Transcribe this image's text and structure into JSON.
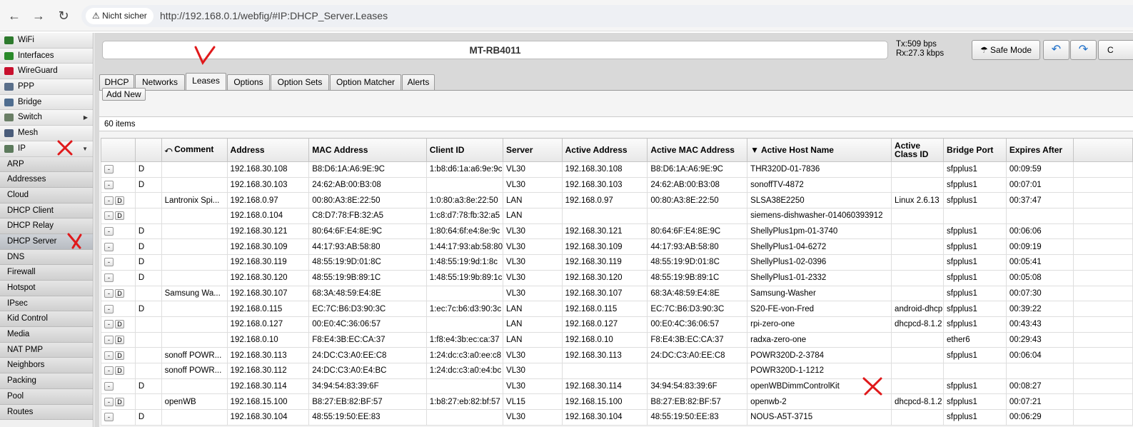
{
  "browser": {
    "back": "←",
    "forward": "→",
    "reload": "↻",
    "insecure": "⚠ Nicht sicher",
    "url": "http://192.168.0.1/webfig/#IP:DHCP_Server.Leases"
  },
  "sidebar": {
    "items": [
      {
        "label": "WiFi",
        "icon_color": "#2d7a2d",
        "has_arrow": false
      },
      {
        "label": "Interfaces",
        "icon_color": "#2a8a2a",
        "has_arrow": false
      },
      {
        "label": "WireGuard",
        "icon_color": "#c8102e",
        "has_arrow": false
      },
      {
        "label": "PPP",
        "icon_color": "#5a6f8a",
        "has_arrow": false
      },
      {
        "label": "Bridge",
        "icon_color": "#4f6d8f",
        "has_arrow": false
      },
      {
        "label": "Switch",
        "icon_color": "#6a7f66",
        "has_arrow": true
      },
      {
        "label": "Mesh",
        "icon_color": "#4a5c7a",
        "has_arrow": false
      },
      {
        "label": "IP",
        "icon_color": "#5c7a5c",
        "has_arrow": true
      }
    ],
    "arrow": "▶",
    "open_arrow": "▼",
    "sub_items": [
      "ARP",
      "Addresses",
      "Cloud",
      "DHCP Client",
      "DHCP Relay",
      "DHCP Server",
      "DNS",
      "Firewall",
      "Hotspot",
      "IPsec",
      "Kid Control",
      "Media",
      "NAT PMP",
      "Neighbors",
      "Packing",
      "Pool",
      "Routes"
    ],
    "active_sub": "DHCP Server"
  },
  "header": {
    "title": "MT-RB4011",
    "tx": "Tx:509 bps",
    "rx": "Rx:27.3 kbps",
    "safe_mode": "Safe Mode",
    "undo": "↶",
    "redo": "↷",
    "extra": "C"
  },
  "tabs": [
    "DHCP",
    "Networks",
    "Leases",
    "Options",
    "Option Sets",
    "Option Matcher",
    "Alerts"
  ],
  "active_tab": "Leases",
  "toolbar": {
    "add_new": "Add New"
  },
  "items_count": "60 items",
  "table": {
    "columns": [
      "",
      "",
      "Comment",
      "Address",
      "MAC Address",
      "Client ID",
      "Server",
      "Active Address",
      "Active MAC Address",
      "▼ Active Host Name",
      "Active Class ID",
      "Bridge Port",
      "Expires After",
      ""
    ],
    "rows": [
      {
        "d_btn": false,
        "flag": "D",
        "comment": "",
        "address": "192.168.30.108",
        "mac": "B8:D6:1A:A6:9E:9C",
        "client_id": "1:b8:d6:1a:a6:9e:9c",
        "server": "VL30",
        "active_address": "192.168.30.108",
        "active_mac": "B8:D6:1A:A6:9E:9C",
        "host": "THR320D-01-7836",
        "class_id": "",
        "bridge_port": "sfpplus1",
        "expires": "00:09:59"
      },
      {
        "d_btn": false,
        "flag": "D",
        "comment": "",
        "address": "192.168.30.103",
        "mac": "24:62:AB:00:B3:08",
        "client_id": "",
        "server": "VL30",
        "active_address": "192.168.30.103",
        "active_mac": "24:62:AB:00:B3:08",
        "host": "sonoffTV-4872",
        "class_id": "",
        "bridge_port": "sfpplus1",
        "expires": "00:07:01"
      },
      {
        "d_btn": true,
        "flag": "",
        "comment": "Lantronix Spi...",
        "address": "192.168.0.97",
        "mac": "00:80:A3:8E:22:50",
        "client_id": "1:0:80:a3:8e:22:50",
        "server": "LAN",
        "active_address": "192.168.0.97",
        "active_mac": "00:80:A3:8E:22:50",
        "host": "SLSA38E2250",
        "class_id": "Linux 2.6.13",
        "bridge_port": "sfpplus1",
        "expires": "00:37:47"
      },
      {
        "d_btn": true,
        "flag": "",
        "comment": "",
        "address": "192.168.0.104",
        "mac": "C8:D7:78:FB:32:A5",
        "client_id": "1:c8:d7:78:fb:32:a5",
        "server": "LAN",
        "active_address": "",
        "active_mac": "",
        "host": "siemens-dishwasher-014060393912",
        "class_id": "",
        "bridge_port": "",
        "expires": ""
      },
      {
        "d_btn": false,
        "flag": "D",
        "comment": "",
        "address": "192.168.30.121",
        "mac": "80:64:6F:E4:8E:9C",
        "client_id": "1:80:64:6f:e4:8e:9c",
        "server": "VL30",
        "active_address": "192.168.30.121",
        "active_mac": "80:64:6F:E4:8E:9C",
        "host": "ShellyPlus1pm-01-3740",
        "class_id": "",
        "bridge_port": "sfpplus1",
        "expires": "00:06:06"
      },
      {
        "d_btn": false,
        "flag": "D",
        "comment": "",
        "address": "192.168.30.109",
        "mac": "44:17:93:AB:58:80",
        "client_id": "1:44:17:93:ab:58:80",
        "server": "VL30",
        "active_address": "192.168.30.109",
        "active_mac": "44:17:93:AB:58:80",
        "host": "ShellyPlus1-04-6272",
        "class_id": "",
        "bridge_port": "sfpplus1",
        "expires": "00:09:19"
      },
      {
        "d_btn": false,
        "flag": "D",
        "comment": "",
        "address": "192.168.30.119",
        "mac": "48:55:19:9D:01:8C",
        "client_id": "1:48:55:19:9d:1:8c",
        "server": "VL30",
        "active_address": "192.168.30.119",
        "active_mac": "48:55:19:9D:01:8C",
        "host": "ShellyPlus1-02-0396",
        "class_id": "",
        "bridge_port": "sfpplus1",
        "expires": "00:05:41"
      },
      {
        "d_btn": false,
        "flag": "D",
        "comment": "",
        "address": "192.168.30.120",
        "mac": "48:55:19:9B:89:1C",
        "client_id": "1:48:55:19:9b:89:1c",
        "server": "VL30",
        "active_address": "192.168.30.120",
        "active_mac": "48:55:19:9B:89:1C",
        "host": "ShellyPlus1-01-2332",
        "class_id": "",
        "bridge_port": "sfpplus1",
        "expires": "00:05:08"
      },
      {
        "d_btn": true,
        "flag": "",
        "comment": "Samsung Wa...",
        "address": "192.168.30.107",
        "mac": "68:3A:48:59:E4:8E",
        "client_id": "",
        "server": "VL30",
        "active_address": "192.168.30.107",
        "active_mac": "68:3A:48:59:E4:8E",
        "host": "Samsung-Washer",
        "class_id": "",
        "bridge_port": "sfpplus1",
        "expires": "00:07:30"
      },
      {
        "d_btn": false,
        "flag": "D",
        "comment": "",
        "address": "192.168.0.115",
        "mac": "EC:7C:B6:D3:90:3C",
        "client_id": "1:ec:7c:b6:d3:90:3c",
        "server": "LAN",
        "active_address": "192.168.0.115",
        "active_mac": "EC:7C:B6:D3:90:3C",
        "host": "S20-FE-von-Fred",
        "class_id": "android-dhcp",
        "bridge_port": "sfpplus1",
        "expires": "00:39:22"
      },
      {
        "d_btn": true,
        "flag": "",
        "comment": "",
        "address": "192.168.0.127",
        "mac": "00:E0:4C:36:06:57",
        "client_id": "",
        "server": "LAN",
        "active_address": "192.168.0.127",
        "active_mac": "00:E0:4C:36:06:57",
        "host": "rpi-zero-one",
        "class_id": "dhcpcd-8.1.2",
        "bridge_port": "sfpplus1",
        "expires": "00:43:43"
      },
      {
        "d_btn": true,
        "flag": "",
        "comment": "",
        "address": "192.168.0.10",
        "mac": "F8:E4:3B:EC:CA:37",
        "client_id": "1:f8:e4:3b:ec:ca:37",
        "server": "LAN",
        "active_address": "192.168.0.10",
        "active_mac": "F8:E4:3B:EC:CA:37",
        "host": "radxa-zero-one",
        "class_id": "",
        "bridge_port": "ether6",
        "expires": "00:29:43"
      },
      {
        "d_btn": true,
        "flag": "",
        "comment": "sonoff POWR...",
        "address": "192.168.30.113",
        "mac": "24:DC:C3:A0:EE:C8",
        "client_id": "1:24:dc:c3:a0:ee:c8",
        "server": "VL30",
        "active_address": "192.168.30.113",
        "active_mac": "24:DC:C3:A0:EE:C8",
        "host": "POWR320D-2-3784",
        "class_id": "",
        "bridge_port": "sfpplus1",
        "expires": "00:06:04"
      },
      {
        "d_btn": true,
        "flag": "",
        "comment": "sonoff POWR...",
        "address": "192.168.30.112",
        "mac": "24:DC:C3:A0:E4:BC",
        "client_id": "1:24:dc:c3:a0:e4:bc",
        "server": "VL30",
        "active_address": "",
        "active_mac": "",
        "host": "POWR320D-1-1212",
        "class_id": "",
        "bridge_port": "",
        "expires": ""
      },
      {
        "d_btn": false,
        "flag": "D",
        "comment": "",
        "address": "192.168.30.114",
        "mac": "34:94:54:83:39:6F",
        "client_id": "",
        "server": "VL30",
        "active_address": "192.168.30.114",
        "active_mac": "34:94:54:83:39:6F",
        "host": "openWBDimmControlKit",
        "class_id": "",
        "bridge_port": "sfpplus1",
        "expires": "00:08:27"
      },
      {
        "d_btn": true,
        "flag": "",
        "comment": "openWB",
        "address": "192.168.15.100",
        "mac": "B8:27:EB:82:BF:57",
        "client_id": "1:b8:27:eb:82:bf:57",
        "server": "VL15",
        "active_address": "192.168.15.100",
        "active_mac": "B8:27:EB:82:BF:57",
        "host": "openwb-2",
        "class_id": "dhcpcd-8.1.2",
        "bridge_port": "sfpplus1",
        "expires": "00:07:21"
      },
      {
        "d_btn": false,
        "flag": "D",
        "comment": "",
        "address": "192.168.30.104",
        "mac": "48:55:19:50:EE:83",
        "client_id": "",
        "server": "VL30",
        "active_address": "192.168.30.104",
        "active_mac": "48:55:19:50:EE:83",
        "host": "NOUS-A5T-3715",
        "class_id": "",
        "bridge_port": "sfpplus1",
        "expires": "00:06:29"
      }
    ]
  },
  "colors": {
    "annotation_red": "#e0191b",
    "tab_bg": "#d9d9d9"
  }
}
